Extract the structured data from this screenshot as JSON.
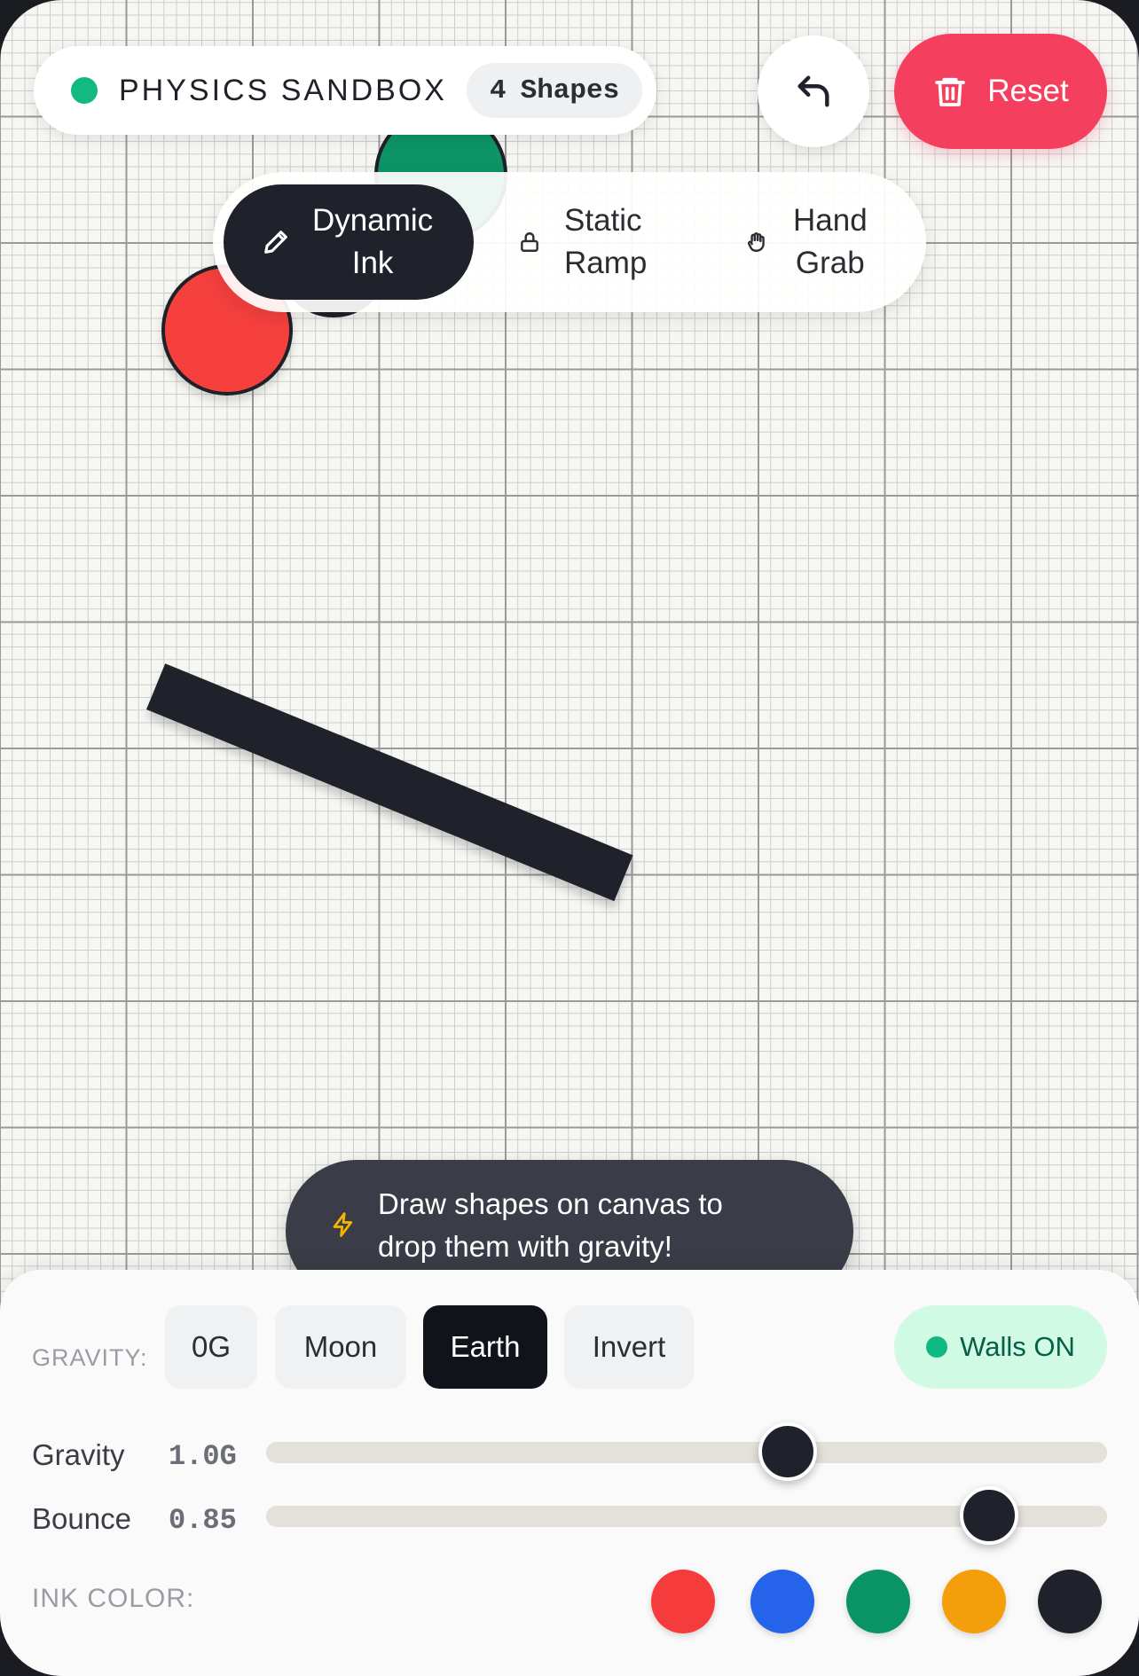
{
  "header": {
    "title": "PHYSICS SANDBOX",
    "shape_count": "4",
    "shape_count_label": "Shapes"
  },
  "actions": {
    "undo_icon": "undo-arrow-icon",
    "reset_label": "Reset",
    "reset_icon": "trash-icon"
  },
  "tools": [
    {
      "label_line1": "Dynamic",
      "label_line2": "Ink",
      "icon": "pencil-icon",
      "active": true
    },
    {
      "label_line1": "Static",
      "label_line2": "Ramp",
      "icon": "lock-icon",
      "active": false
    },
    {
      "label_line1": "Hand",
      "label_line2": "Grab",
      "icon": "hand-icon",
      "active": false
    }
  ],
  "toast": {
    "line1": "Draw shapes on canvas to",
    "line2": "drop them with gravity!",
    "icon": "lightning-icon"
  },
  "panel": {
    "gravity_caption": "GRAVITY:",
    "presets": [
      "0G",
      "Moon",
      "Earth",
      "Invert"
    ],
    "active_preset": "Earth",
    "walls_label": "Walls ON",
    "sliders": [
      {
        "label": "Gravity",
        "value": "1.0G",
        "fraction": 0.62
      },
      {
        "label": "Bounce",
        "value": "0.85",
        "fraction": 0.86
      }
    ],
    "ink_caption": "INK COLOR:",
    "ink_colors": [
      "#f53b3b",
      "#2563eb",
      "#0a9466",
      "#f59e0b",
      "#1f222b"
    ]
  },
  "colors": {
    "accent_reset": "#f43f5e",
    "status_green": "#12b981",
    "dark": "#1f222b"
  }
}
